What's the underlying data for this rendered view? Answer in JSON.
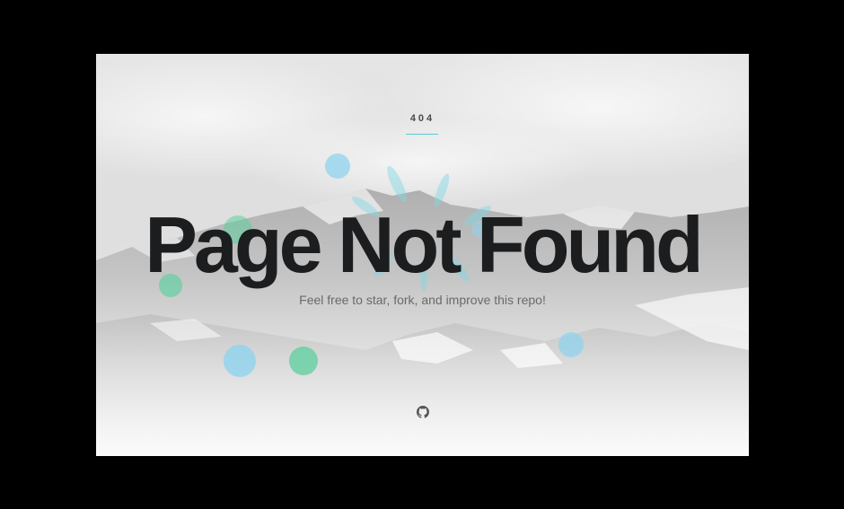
{
  "page": {
    "status_code": "404",
    "headline": "Page Not Found",
    "subtext": "Feel free to star, fork, and improve this repo!"
  },
  "links": {
    "github_icon": "github-icon"
  },
  "colors": {
    "background": "#000000",
    "accent": "#5ec9d6",
    "headline": "#1c1d1f",
    "bubble_blue": "#8fd3ee",
    "bubble_green": "#5ccf9e"
  }
}
